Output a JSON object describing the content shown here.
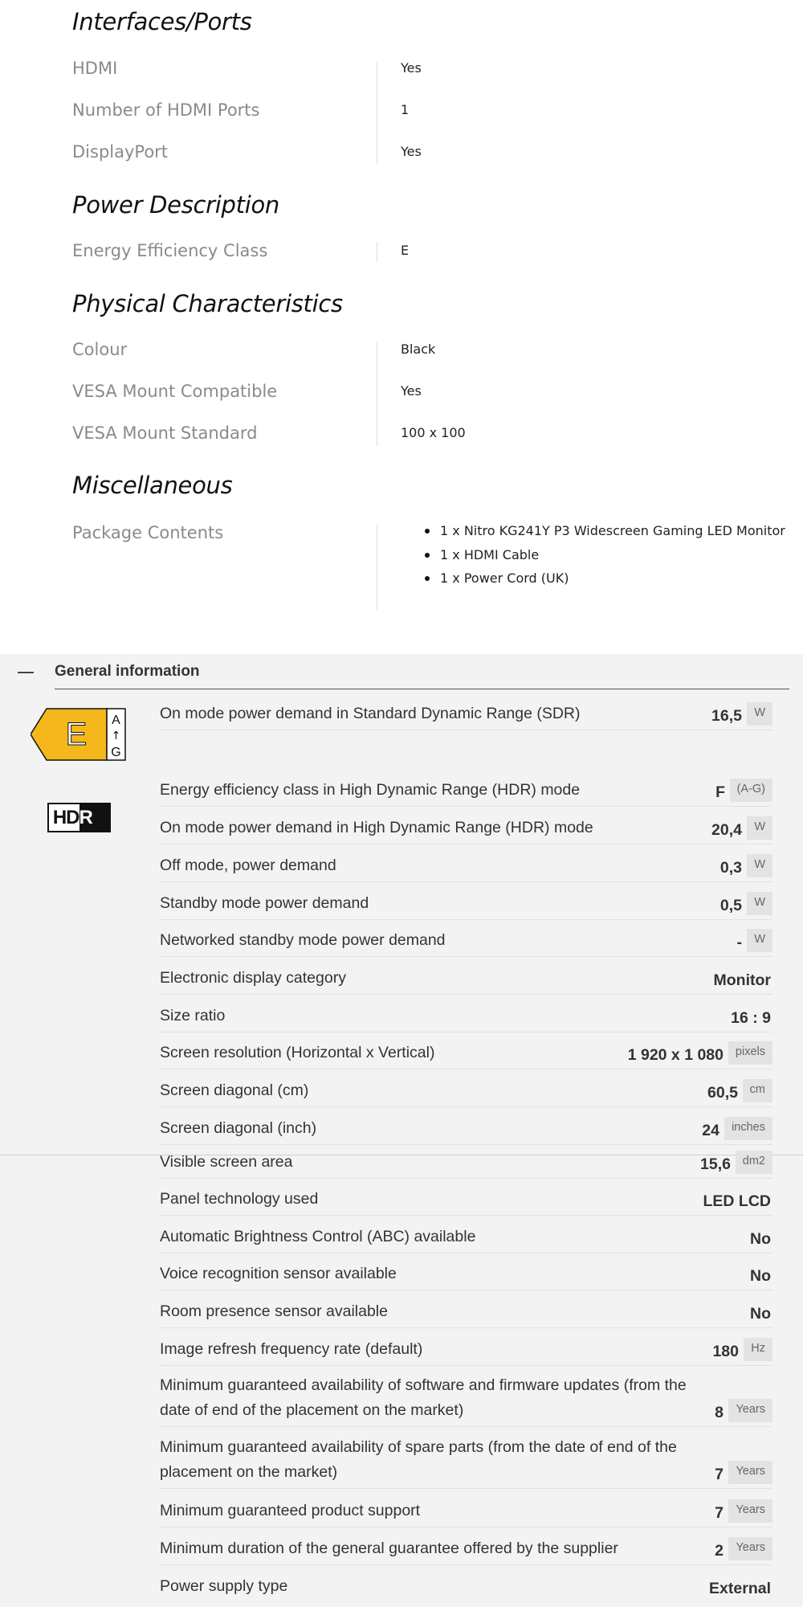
{
  "specs": {
    "sections": [
      {
        "title": "Interfaces/Ports",
        "rows": [
          {
            "label": "HDMI",
            "value": "Yes"
          },
          {
            "label": "Number of HDMI Ports",
            "value": "1"
          },
          {
            "label": "DisplayPort",
            "value": "Yes"
          }
        ]
      },
      {
        "title": "Power Description",
        "rows": [
          {
            "label": "Energy Efficiency Class",
            "value": "E"
          }
        ]
      },
      {
        "title": "Physical Characteristics",
        "rows": [
          {
            "label": "Colour",
            "value": "Black"
          },
          {
            "label": "VESA Mount Compatible",
            "value": "Yes"
          },
          {
            "label": "VESA Mount Standard",
            "value": "100 x 100"
          }
        ]
      },
      {
        "title": "Miscellaneous",
        "rows": [
          {
            "label": "Package Contents",
            "items": [
              "1 x Nitro KG241Y P3 Widescreen Gaming LED Monitor",
              "1 x HDMI Cable",
              "1 x Power Cord (UK)"
            ]
          }
        ]
      }
    ]
  },
  "eprel": {
    "section_title": "General information",
    "energy_label": {
      "class": "E",
      "scale_top": "A",
      "scale_arrow": "↑",
      "scale_bottom": "G",
      "color": "#f4b71c"
    },
    "hdr_logo": {
      "left": "HD",
      "right": "R"
    },
    "rows": [
      {
        "label": "On mode power demand in Standard Dynamic Range (SDR)",
        "value": "16,5",
        "unit": "W"
      },
      {
        "label": "Energy efficiency class in High Dynamic Range (HDR) mode",
        "value": "F",
        "unit": "(A-G)"
      },
      {
        "label": "On mode power demand in High Dynamic Range (HDR) mode",
        "value": "20,4",
        "unit": "W"
      },
      {
        "label": "Off mode, power demand",
        "value": "0,3",
        "unit": "W"
      },
      {
        "label": "Standby mode power demand",
        "value": "0,5",
        "unit": "W"
      },
      {
        "label": "Networked standby mode power demand",
        "value": "-",
        "unit": "W"
      },
      {
        "label": "Electronic display category",
        "value": "Monitor",
        "unit": ""
      },
      {
        "label": "Size ratio",
        "value": "16 : 9",
        "unit": ""
      },
      {
        "label": "Screen resolution (Horizontal x Vertical)",
        "value": "1 920 x 1 080",
        "unit": "pixels"
      },
      {
        "label": "Screen diagonal (cm)",
        "value": "60,5",
        "unit": "cm"
      },
      {
        "label": "Screen diagonal (inch)",
        "value": "24",
        "unit": "inches"
      },
      {
        "label": "Visible screen area",
        "value": "15,6",
        "unit": "dm2"
      },
      {
        "label": "Panel technology used",
        "value": "LED LCD",
        "unit": ""
      },
      {
        "label": "Automatic Brightness Control (ABC) available",
        "value": "No",
        "unit": ""
      },
      {
        "label": "Voice recognition sensor available",
        "value": "No",
        "unit": ""
      },
      {
        "label": "Room presence sensor available",
        "value": "No",
        "unit": ""
      },
      {
        "label": "Image refresh frequency rate (default)",
        "value": "180",
        "unit": "Hz"
      },
      {
        "label": "Minimum guaranteed availability of software and firmware updates (from the date of end of the placement on the market)",
        "value": "8",
        "unit": "Years"
      },
      {
        "label": "Minimum guaranteed availability of spare parts (from the date of end of the placement on the market)",
        "value": "7",
        "unit": "Years"
      },
      {
        "label": "Minimum guaranteed product support",
        "value": "7",
        "unit": "Years"
      },
      {
        "label": "Minimum duration of the general guarantee offered by the supplier",
        "value": "2",
        "unit": "Years"
      },
      {
        "label": "Power supply type",
        "value": "External",
        "unit": ""
      }
    ]
  }
}
